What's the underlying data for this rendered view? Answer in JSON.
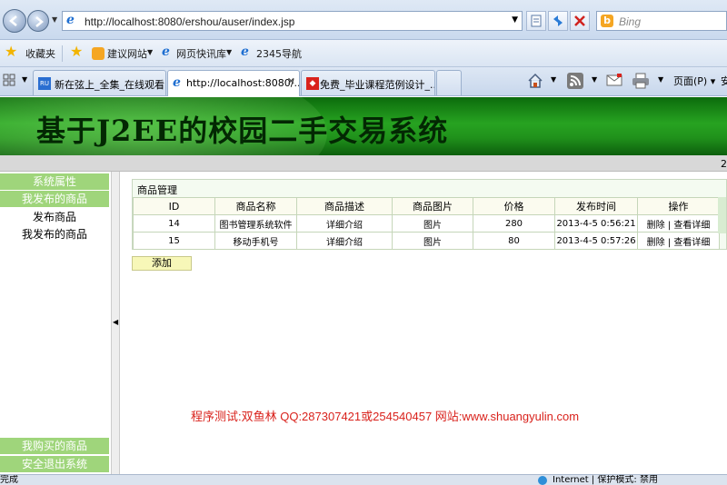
{
  "browser": {
    "url": "http://localhost:8080/ershou/auser/index.jsp",
    "search_placeholder": "Bing",
    "search_engine_icon": "b"
  },
  "favorites_bar": {
    "favorites_label": "收藏夹",
    "items": [
      "建议网站",
      "网页快讯库",
      "2345导航"
    ]
  },
  "tabs": [
    {
      "label": "新在弦上_全集_在线观看 -...",
      "icon": "RU"
    },
    {
      "label": "http://localhost:8080/...",
      "icon": "e"
    },
    {
      "label": "免费_毕业课程范例设计_...",
      "icon": "◆"
    }
  ],
  "command_bar": {
    "page_label": "页面(P)",
    "safety_label": "安"
  },
  "page": {
    "banner_title": "基于J2EE的校园二手交易系统",
    "strip_text": "2",
    "sidebar": {
      "section_system": "系统属性",
      "section_my_items": "我发布的商品",
      "links": [
        "发布商品",
        "我发布的商品"
      ],
      "section_bought": "我购买的商品",
      "section_logout": "安全退出系统"
    },
    "panel_title": "商品管理",
    "table": {
      "headers": [
        "ID",
        "商品名称",
        "商品描述",
        "商品图片",
        "价格",
        "发布时间",
        "操作"
      ],
      "rows": [
        {
          "id": "14",
          "name": "图书管理系统软件",
          "desc": "详细介绍",
          "image": "图片",
          "price": "280",
          "time": "2013-4-5 0:56:21",
          "op_delete": "删除",
          "op_view": "查看详细"
        },
        {
          "id": "15",
          "name": "移动手机号",
          "desc": "详细介绍",
          "image": "图片",
          "price": "80",
          "time": "2013-4-5 0:57:26",
          "op_delete": "删除",
          "op_view": "查看详细"
        }
      ]
    },
    "add_button": "添加",
    "footer_note": "程序测试:双鱼林 QQ:287307421或254540457 网站:www.shuangyulin.com"
  },
  "status_bar": {
    "left": "完成",
    "zone": "Internet | 保护模式: 禁用"
  },
  "colors": {
    "banner_green": "#27a321",
    "sidebar_header": "#9fd57b",
    "footer_note": "#d9221c",
    "add_button": "#f7f7b8"
  }
}
